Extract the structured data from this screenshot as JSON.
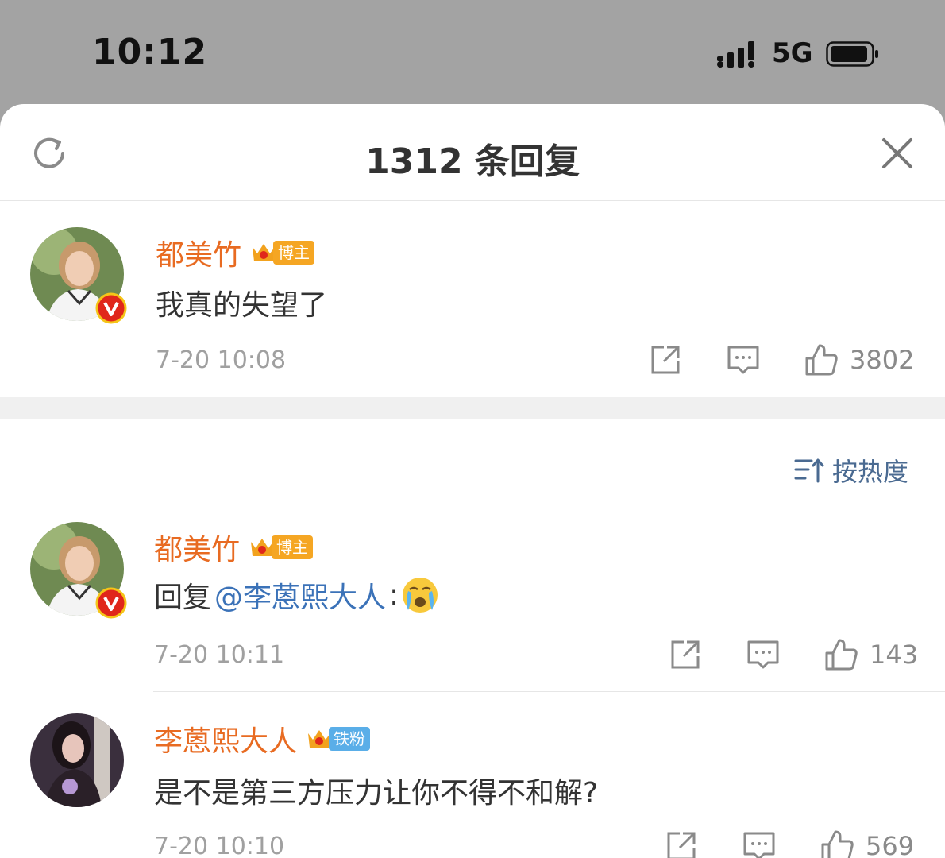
{
  "status_bar": {
    "time": "10:12",
    "network": "5G",
    "signal_icon": "cellular-signal-icon",
    "battery_icon": "battery-icon"
  },
  "header": {
    "title": "1312 条回复",
    "refresh_icon": "refresh-icon",
    "close_icon": "close-icon"
  },
  "main_comment": {
    "user": "都美竹",
    "badge": "博主",
    "text": "我真的失望了",
    "time": "7-20 10:08",
    "likes": "3802"
  },
  "sort": {
    "label": "按热度",
    "icon": "sort-icon"
  },
  "replies": [
    {
      "user": "都美竹",
      "badge": "博主",
      "text_prefix": "回复",
      "mention": "@李蒽熙大人",
      "text_suffix": ":",
      "emoji": "crying-face-emoji",
      "time": "7-20 10:11",
      "likes": "143"
    },
    {
      "user": "李蒽熙大人",
      "badge": "铁粉",
      "text": "是不是第三方压力让你不得不和解?",
      "time": "7-20 10:10",
      "likes": "569"
    }
  ],
  "colors": {
    "username": "#e86b22",
    "mention": "#3b72b8",
    "owner_badge": "#f5a623",
    "fan_badge": "#5aaee8",
    "verified": "#e0271b"
  }
}
